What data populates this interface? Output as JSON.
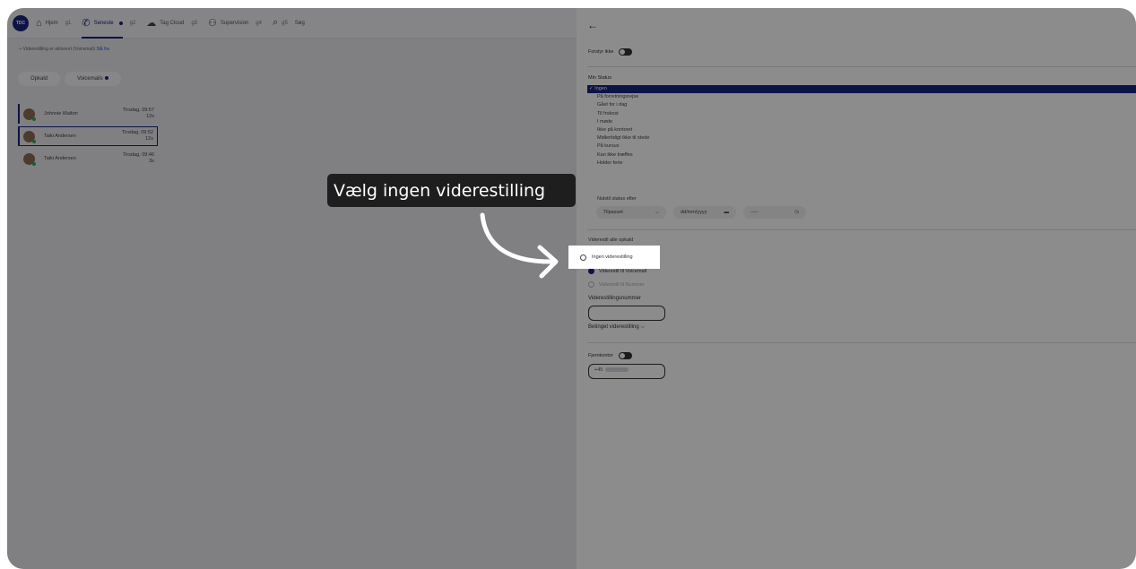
{
  "nav": {
    "logo": "TDC",
    "items": [
      {
        "label": "Hjem",
        "hotkey": "g1",
        "icon": "home-icon",
        "glyph": "⌂"
      },
      {
        "label": "Seneste",
        "hotkey": "g2",
        "icon": "phone-icon",
        "glyph": "✆"
      },
      {
        "label": "Tag Cloud",
        "hotkey": "g3",
        "icon": "cloud-icon",
        "glyph": "☁"
      },
      {
        "label": "Supervision",
        "hotkey": "g4",
        "icon": "supervision-icon",
        "glyph": "⚇"
      },
      {
        "label": "Søg",
        "hotkey": "g5",
        "icon": "search-icon",
        "glyph": "⌕"
      }
    ]
  },
  "banner": {
    "text": "Viderestilling er aktiveret (Voicemail)",
    "link": "Slå fra"
  },
  "subtabs": [
    "Opkald",
    "Voicemails"
  ],
  "calls": [
    {
      "name": "Johnnie Walton",
      "time": "Tirsdag, 09:57",
      "duration": "12s"
    },
    {
      "name": "Taiki Andersen",
      "time": "Tirsdag, 09:52",
      "duration": "12s"
    },
    {
      "name": "Taiki Andersen",
      "time": "Tirsdag, 09:46",
      "duration": "3s"
    }
  ],
  "panel": {
    "back_glyph": "←",
    "dnd_label": "Forstyr ikke",
    "status_label": "Min Status",
    "statuses": [
      "Ingen",
      "På forretningsrejse",
      "Gået for i dag",
      "Til frokost",
      "I møde",
      "Ikke på kontoret",
      "Midlertidigt ikke til stede",
      "På kursus",
      "Kan ikke træffes",
      "Holder ferie"
    ],
    "selected_check": "✓",
    "reset_label": "Nulstil status efter",
    "reset_select": "Tilpasset",
    "reset_date": "dd/mm/yyyy",
    "reset_time": "--:--",
    "forward_label": "Viderestil alle opkald",
    "forward_options": [
      "Ingen viderestilling",
      "Viderestil til Voicemail",
      "Viderestil til Nummer"
    ],
    "forward_number_label": "Viderestillingsnummer",
    "conditional_label": "Betinget viderestilling",
    "remote_label": "Fjernkontor",
    "remote_prefix": "+45"
  },
  "overlay": {
    "tooltip": "Vælg ingen viderestilling"
  }
}
